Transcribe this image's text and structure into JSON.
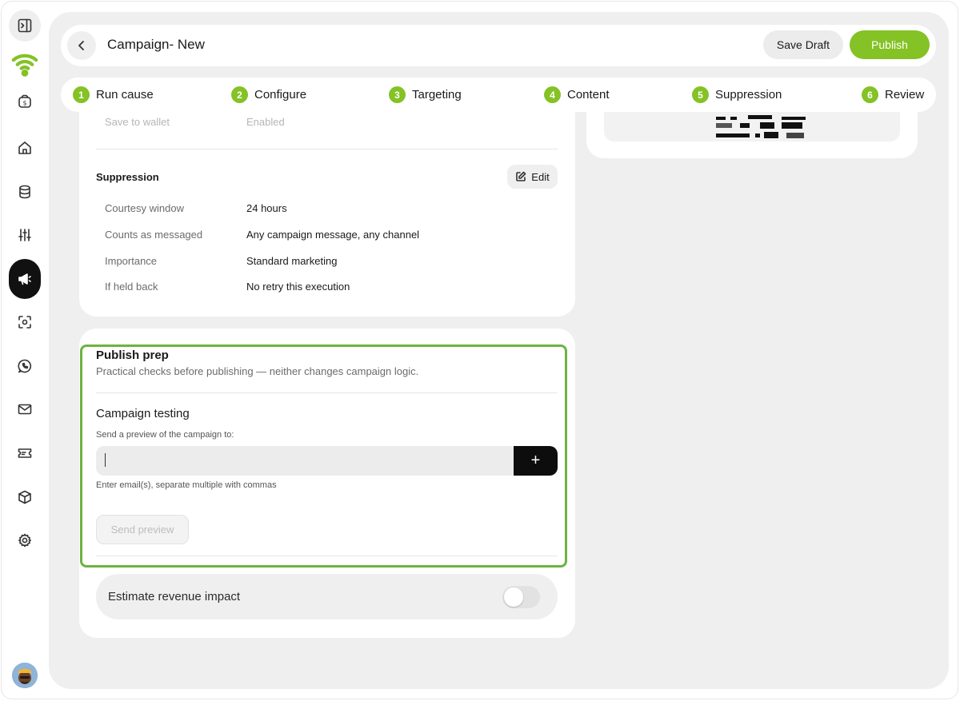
{
  "header": {
    "title": "Campaign- New",
    "save_draft": "Save Draft",
    "publish": "Publish"
  },
  "steps": [
    {
      "num": "1",
      "label": "Run cause"
    },
    {
      "num": "2",
      "label": "Configure"
    },
    {
      "num": "3",
      "label": "Targeting"
    },
    {
      "num": "4",
      "label": "Content"
    },
    {
      "num": "5",
      "label": "Suppression"
    },
    {
      "num": "6",
      "label": "Review"
    }
  ],
  "summary": {
    "faded_key": "Save to wallet",
    "faded_value": "Enabled"
  },
  "suppression": {
    "title": "Suppression",
    "edit_label": "Edit",
    "rows": [
      {
        "key": "Courtesy window",
        "value": "24 hours"
      },
      {
        "key": "Counts as messaged",
        "value": "Any campaign message, any channel"
      },
      {
        "key": "Importance",
        "value": "Standard marketing"
      },
      {
        "key": "If held back",
        "value": "No retry this execution"
      }
    ]
  },
  "publish_prep": {
    "title": "Publish prep",
    "subtitle": "Practical checks before publishing — neither changes campaign logic.",
    "testing_title": "Campaign testing",
    "send_to_label": "Send a preview of the campaign to:",
    "email_value": "",
    "add_symbol": "+",
    "hint": "Enter email(s), separate multiple with commas",
    "send_preview": "Send preview"
  },
  "revenue": {
    "label": "Estimate revenue impact",
    "enabled": false
  },
  "colors": {
    "accent": "#84c225",
    "highlight_border": "#6db33f",
    "canvas": "#efefef",
    "active_nav": "#111111"
  },
  "sidebar": {
    "icons": [
      "sidebar-toggle-icon",
      "wifi-logo-icon",
      "wallet-icon",
      "home-icon",
      "database-icon",
      "sliders-icon",
      "megaphone-icon",
      "scan-icon",
      "whatsapp-icon",
      "mail-icon",
      "ticket-icon",
      "box-icon",
      "gear-icon"
    ],
    "active": "megaphone-icon"
  }
}
